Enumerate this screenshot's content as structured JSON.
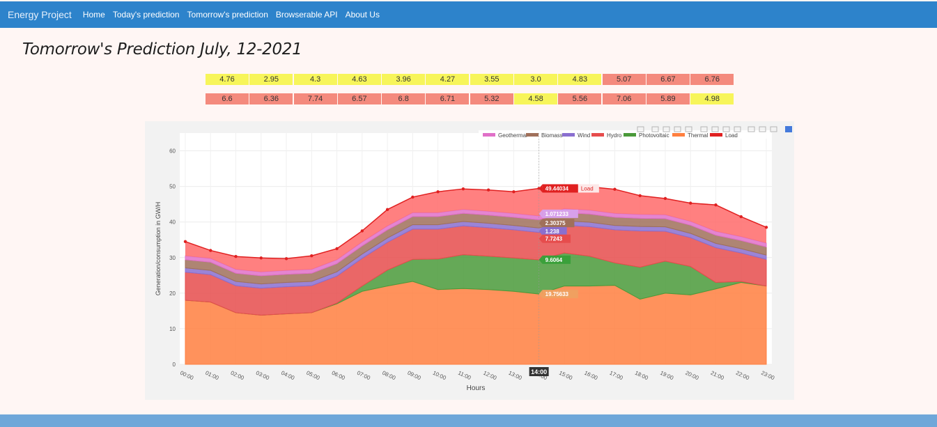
{
  "navbar": {
    "brand": "Energy Project",
    "links": [
      "Home",
      "Today's prediction",
      "Tomorrow's prediction",
      "Browserable API",
      "About Us"
    ]
  },
  "page": {
    "title": "Tomorrow's Prediction July, 12-2021"
  },
  "prices": {
    "row1": [
      "4.76",
      "2.95",
      "4.3",
      "4.63",
      "3.96",
      "4.27",
      "3.55",
      "3.0",
      "4.83",
      "5.07",
      "6.67",
      "6.76"
    ],
    "row2": [
      "6.6",
      "6.36",
      "7.74",
      "6.57",
      "6.8",
      "6.71",
      "5.32",
      "4.58",
      "5.56",
      "7.06",
      "5.89",
      "4.98"
    ],
    "colors": {
      "low": "#f7f55a",
      "high": "#f48a7d"
    },
    "threshold": 5.0
  },
  "chart_data": {
    "type": "area",
    "xlabel": "Hours",
    "ylabel": "Generation/consumption in  GW/H",
    "ylim": [
      0,
      65
    ],
    "yticks": [
      0,
      10,
      20,
      30,
      40,
      50,
      60
    ],
    "x": [
      "00:00",
      "01:00",
      "02:00",
      "03:00",
      "04:00",
      "05:00",
      "06:00",
      "07:00",
      "08:00",
      "09:00",
      "10:00",
      "11:00",
      "12:00",
      "13:00",
      "14:00",
      "15:00",
      "16:00",
      "17:00",
      "18:00",
      "19:00",
      "20:00",
      "21:00",
      "22:00",
      "23:00"
    ],
    "series": [
      {
        "name": "Thermal",
        "color": "#ff7f3f",
        "values": [
          18,
          17.5,
          14.5,
          13.8,
          14.2,
          14.5,
          17,
          20.5,
          22,
          23.3,
          21,
          21.3,
          21,
          20.5,
          19.75,
          22,
          22,
          22.2,
          18.3,
          20,
          19.5,
          21.2,
          23,
          22
        ]
      },
      {
        "name": "Photovoltaic",
        "color": "#4a9a3a",
        "values": [
          0,
          0,
          0,
          0,
          0,
          0,
          0.2,
          1.5,
          4.5,
          6.2,
          8.6,
          9.5,
          9.4,
          9.4,
          9.61,
          9.3,
          8.4,
          6.3,
          9,
          9,
          8,
          1.8,
          0.3,
          0
        ]
      },
      {
        "name": "Hydro",
        "color": "#e64c4c",
        "values": [
          7.9,
          7.7,
          7.6,
          7.6,
          7.6,
          7.6,
          7.6,
          7.8,
          7.8,
          8.5,
          8.4,
          8.1,
          8,
          7.9,
          7.72,
          7.8,
          8.3,
          9.3,
          10.2,
          8.4,
          8.1,
          9.8,
          8,
          7.5
        ]
      },
      {
        "name": "Wind",
        "color": "#8a6fd0",
        "values": [
          1.2,
          1.2,
          1.2,
          1.2,
          1.2,
          1.2,
          1.2,
          1.2,
          1.2,
          1.24,
          1.24,
          1.24,
          1.24,
          1.24,
          1.238,
          1.24,
          1.24,
          1.24,
          1.24,
          1.24,
          1.2,
          1.2,
          1.2,
          1.2
        ]
      },
      {
        "name": "Biomass",
        "color": "#a0705a",
        "values": [
          2.3,
          2.3,
          2.3,
          2.3,
          2.3,
          2.3,
          2.3,
          2.3,
          2.3,
          2.3,
          2.3,
          2.3,
          2.3,
          2.3,
          2.30375,
          2.3,
          2.3,
          2.3,
          2.3,
          2.3,
          2.3,
          2.3,
          2.3,
          2.3
        ]
      },
      {
        "name": "Geothermal",
        "color": "#e070c8",
        "values": [
          1.07,
          1.07,
          1.07,
          1.07,
          1.07,
          1.07,
          1.07,
          1.07,
          1.07,
          1.07,
          1.07,
          1.07,
          1.07,
          1.07,
          1.071233,
          1.07,
          1.07,
          1.07,
          1.07,
          1.07,
          1.07,
          1.07,
          1.07,
          1.07
        ]
      }
    ],
    "load": {
      "name": "Load",
      "color": "#e02020",
      "values": [
        34.5,
        32,
        30.3,
        29.9,
        29.7,
        30.5,
        32.5,
        37.5,
        43.5,
        47,
        48.5,
        49.3,
        49,
        48.5,
        49.44034,
        50,
        49.9,
        49.2,
        47.4,
        46.6,
        45.3,
        44.8,
        41.5,
        38.5
      ]
    },
    "legend": [
      "Geothermal",
      "Biomass",
      "Wind",
      "Hydro",
      "Photovoltaic",
      "Thermal",
      "Load"
    ],
    "hover": {
      "x": "14:00",
      "labels": [
        {
          "series": "Load",
          "text": "49.44034",
          "suffix": "Load",
          "y": 49.44034,
          "color": "#e02020"
        },
        {
          "series": "Geothermal",
          "text": "1.071233",
          "y": 42.31,
          "color": "#d7a0ea"
        },
        {
          "series": "Biomass",
          "text": "2.30375",
          "y": 39.7,
          "color": "#a0705a"
        },
        {
          "series": "Wind",
          "text": "1.238",
          "y": 37.4,
          "color": "#8a6fd0"
        },
        {
          "series": "Hydro",
          "text": "7.7243",
          "y": 35.3,
          "color": "#e64c4c"
        },
        {
          "series": "Photovoltaic",
          "text": "9.6064",
          "y": 29.4,
          "color": "#3aa03a"
        },
        {
          "series": "Thermal",
          "text": "19.75633",
          "y": 19.75,
          "color": "#f0a060"
        }
      ]
    }
  }
}
